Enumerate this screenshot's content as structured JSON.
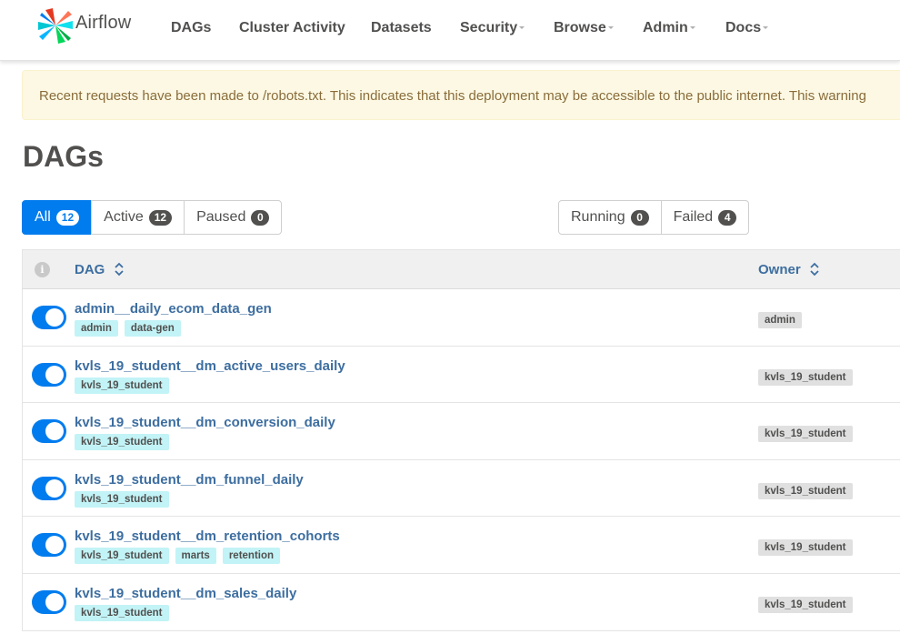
{
  "brand": {
    "name": "Airflow"
  },
  "nav": [
    {
      "label": "DAGs",
      "dropdown": false
    },
    {
      "label": "Cluster Activity",
      "dropdown": false
    },
    {
      "label": "Datasets",
      "dropdown": false
    },
    {
      "label": "Security",
      "dropdown": true
    },
    {
      "label": "Browse",
      "dropdown": true
    },
    {
      "label": "Admin",
      "dropdown": true
    },
    {
      "label": "Docs",
      "dropdown": true
    }
  ],
  "alert": {
    "text": "Recent requests have been made to /robots.txt. This indicates that this deployment may be accessible to the public internet. This warning"
  },
  "page": {
    "title": "DAGs"
  },
  "filters": {
    "status": [
      {
        "label": "All",
        "count": "12",
        "active": true
      },
      {
        "label": "Active",
        "count": "12",
        "active": false
      },
      {
        "label": "Paused",
        "count": "0",
        "active": false
      }
    ],
    "state": [
      {
        "label": "Running",
        "count": "0"
      },
      {
        "label": "Failed",
        "count": "4"
      }
    ]
  },
  "table": {
    "info_icon": "info-icon",
    "columns": {
      "dag": "DAG",
      "owner": "Owner"
    },
    "rows": [
      {
        "name": "admin__daily_ecom_data_gen",
        "tags": [
          "admin",
          "data-gen"
        ],
        "owner": "admin",
        "paused": false
      },
      {
        "name": "kvls_19_student__dm_active_users_daily",
        "tags": [
          "kvls_19_student"
        ],
        "owner": "kvls_19_student",
        "paused": false
      },
      {
        "name": "kvls_19_student__dm_conversion_daily",
        "tags": [
          "kvls_19_student"
        ],
        "owner": "kvls_19_student",
        "paused": false
      },
      {
        "name": "kvls_19_student__dm_funnel_daily",
        "tags": [
          "kvls_19_student"
        ],
        "owner": "kvls_19_student",
        "paused": false
      },
      {
        "name": "kvls_19_student__dm_retention_cohorts",
        "tags": [
          "kvls_19_student",
          "marts",
          "retention"
        ],
        "owner": "kvls_19_student",
        "paused": false
      },
      {
        "name": "kvls_19_student__dm_sales_daily",
        "tags": [
          "kvls_19_student"
        ],
        "owner": "kvls_19_student",
        "paused": false
      }
    ]
  },
  "colors": {
    "accent": "#017cee",
    "link": "#3d6ea0",
    "tag": "#c2f3f6",
    "alert_bg": "#fcf8e3",
    "alert_text": "#8a6d3b"
  }
}
